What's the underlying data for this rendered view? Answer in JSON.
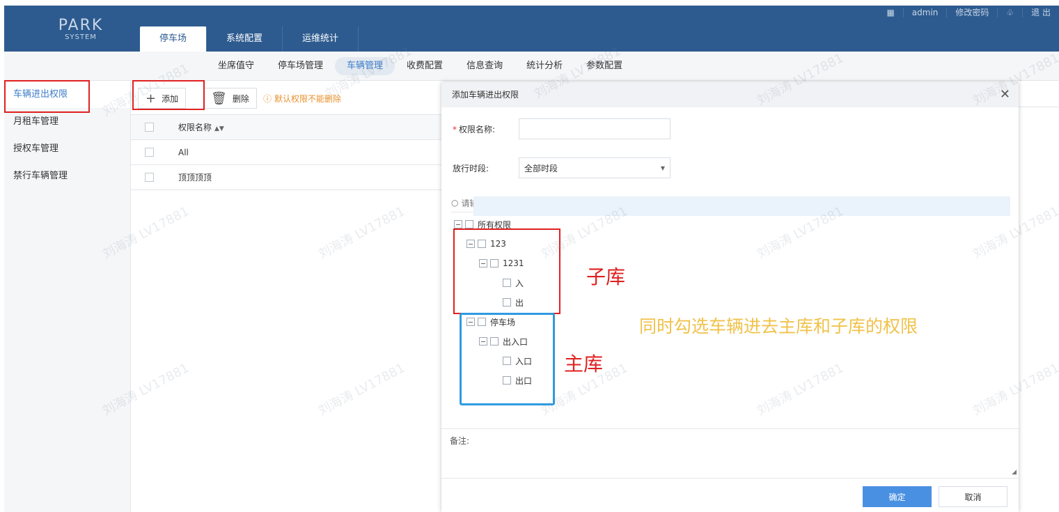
{
  "header": {
    "logo_line1": "PARK",
    "logo_line2": "SYSTEM",
    "tabs": [
      {
        "label": "停车场",
        "active": true
      },
      {
        "label": "系统配置",
        "active": false
      },
      {
        "label": "运维统计",
        "active": false
      }
    ],
    "grid_icon": "▦",
    "user": "admin",
    "change_password": "修改密码",
    "skin_icon": "♧",
    "logout": "退 出"
  },
  "subnav": {
    "items": [
      {
        "label": "坐席值守",
        "active": false
      },
      {
        "label": "停车场管理",
        "active": false
      },
      {
        "label": "车辆管理",
        "active": true
      },
      {
        "label": "收费配置",
        "active": false
      },
      {
        "label": "信息查询",
        "active": false
      },
      {
        "label": "统计分析",
        "active": false
      },
      {
        "label": "参数配置",
        "active": false
      }
    ]
  },
  "sidebar": {
    "items": [
      {
        "label": "车辆进出权限",
        "active": true
      },
      {
        "label": "月租车管理",
        "active": false
      },
      {
        "label": "授权车管理",
        "active": false
      },
      {
        "label": "禁行车辆管理",
        "active": false
      }
    ]
  },
  "toolbar": {
    "add_label": "添加",
    "delete_label": "删除",
    "hint": "默认权限不能删除"
  },
  "table": {
    "header": "权限名称",
    "rows": [
      "All",
      "顶顶顶顶"
    ]
  },
  "modal": {
    "title": "添加车辆进出权限",
    "name_label": "权限名称:",
    "name_value": "",
    "period_label": "放行时段:",
    "period_value": "全部时段",
    "search_placeholder": "请输入关键字",
    "tree": {
      "root": "所有权限",
      "sub_lot": "123",
      "sub_gate": "1231",
      "sub_in": "入",
      "sub_out": "出",
      "main_lot": "停车场",
      "main_gate": "出入口",
      "main_in": "入口",
      "main_out": "出口"
    },
    "remark_label": "备注:",
    "ok": "确定",
    "cancel": "取消"
  },
  "annotations": {
    "sub_label": "子库",
    "main_label": "主库",
    "note": "同时勾选车辆进去主库和子库的权限",
    "colors": {
      "red": "#e02020",
      "blue": "#2f9ae0",
      "yellow": "#f0c24a"
    }
  },
  "watermark": "刘海涛 LV17881",
  "colors": {
    "header": "#2d5b8f",
    "accent": "#3d7cc9",
    "primary_button": "#4a90e2",
    "hint": "#e8902c"
  }
}
